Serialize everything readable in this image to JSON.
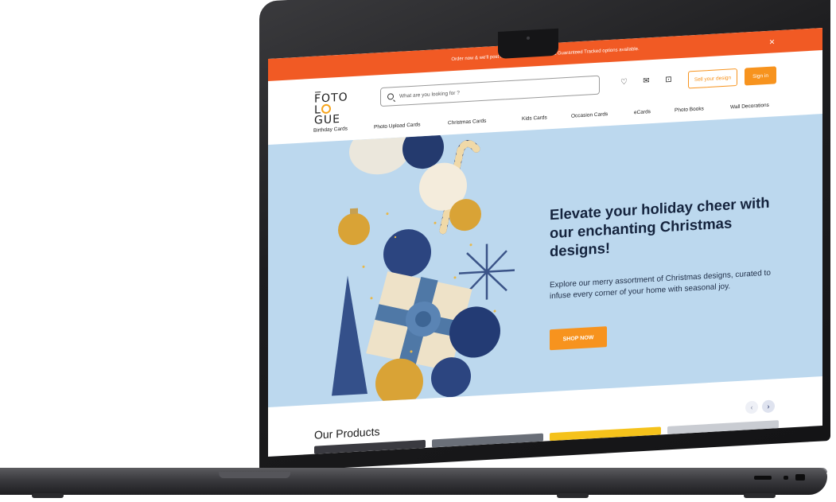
{
  "announcement": {
    "left_text": "Order now & we'll post it t",
    "right_text": "& Guaranteed Tracked options available.",
    "close_glyph": "×"
  },
  "logo": {
    "line1": "F̅OTO",
    "line2_left": "L",
    "line2_right": "GUE"
  },
  "search": {
    "placeholder": "What are you looking for ?"
  },
  "header_icons": [
    {
      "name": "heart-icon",
      "glyph": "♡"
    },
    {
      "name": "mail-icon",
      "glyph": "✉"
    },
    {
      "name": "cart-icon",
      "glyph": "⊡"
    }
  ],
  "buttons": {
    "sell": "Sell your design",
    "signin": "Sign in"
  },
  "nav": {
    "items": [
      "Birthday Cards",
      "Photo Upload Cards",
      "Christmas Cards",
      "Kids Cards",
      "Occasion Cards",
      "eCards",
      "Photo Books",
      "Wall Decorations"
    ]
  },
  "hero": {
    "title": "Elevate your holiday cheer with our enchanting Christmas designs!",
    "subtitle": "Explore our merry assortment of Christmas designs, curated to infuse every corner of your home with seasonal joy.",
    "cta": "SHOP NOW"
  },
  "products": {
    "title": "Our Products",
    "prev": "‹",
    "next": "›"
  },
  "colors": {
    "brand_orange": "#f15a24",
    "accent_orange": "#f7931e",
    "hero_bg": "#bcd8ee",
    "navy": "#14233d"
  }
}
